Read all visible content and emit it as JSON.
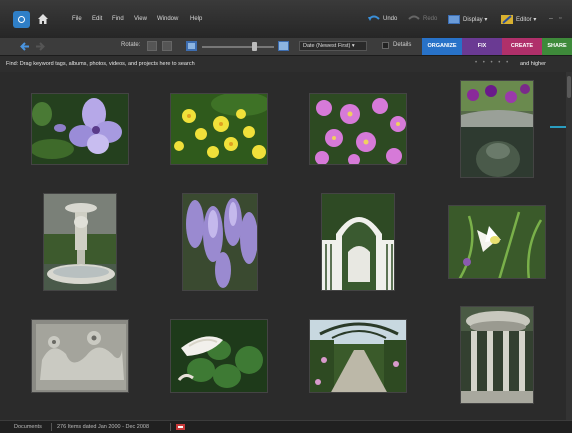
{
  "menubar": {
    "items": [
      "File",
      "Edit",
      "Find",
      "View",
      "Window",
      "Help"
    ],
    "undo_label": "Undo",
    "redo_label": "Redo",
    "display_label": "Display",
    "editor_label": "Editor"
  },
  "toolbar": {
    "rotate_label": "Rotate:",
    "sort_value": "Date (Newest First)",
    "details_label": "Details",
    "tabs": [
      {
        "label": "ORGANIZE",
        "color": "#2872c8"
      },
      {
        "label": "FIX",
        "color": "#6a3a93"
      },
      {
        "label": "CREATE",
        "color": "#b0306a"
      },
      {
        "label": "SHARE",
        "color": "#3e8a3a"
      }
    ]
  },
  "findbar": {
    "text": "Find: Drag keyword tags, albums, photos, videos, and projects here to search",
    "stars": "• • • • •",
    "rating_label": "and higher"
  },
  "thumbnails": [
    {
      "name": "thumb-blue-iris"
    },
    {
      "name": "thumb-yellow-flowers"
    },
    {
      "name": "thumb-pink-daisies"
    },
    {
      "name": "thumb-pansy-planter"
    },
    {
      "name": "thumb-garden-fountain"
    },
    {
      "name": "thumb-wisteria"
    },
    {
      "name": "thumb-white-garden-gate"
    },
    {
      "name": "thumb-white-daffodil"
    },
    {
      "name": "thumb-stone-relief"
    },
    {
      "name": "thumb-calla-lily-leaves"
    },
    {
      "name": "thumb-garden-path"
    },
    {
      "name": "thumb-stone-gazebo"
    }
  ],
  "status": {
    "documents": "Documents",
    "items": "276 Items dated Jan 2000 - Dec 2008"
  }
}
